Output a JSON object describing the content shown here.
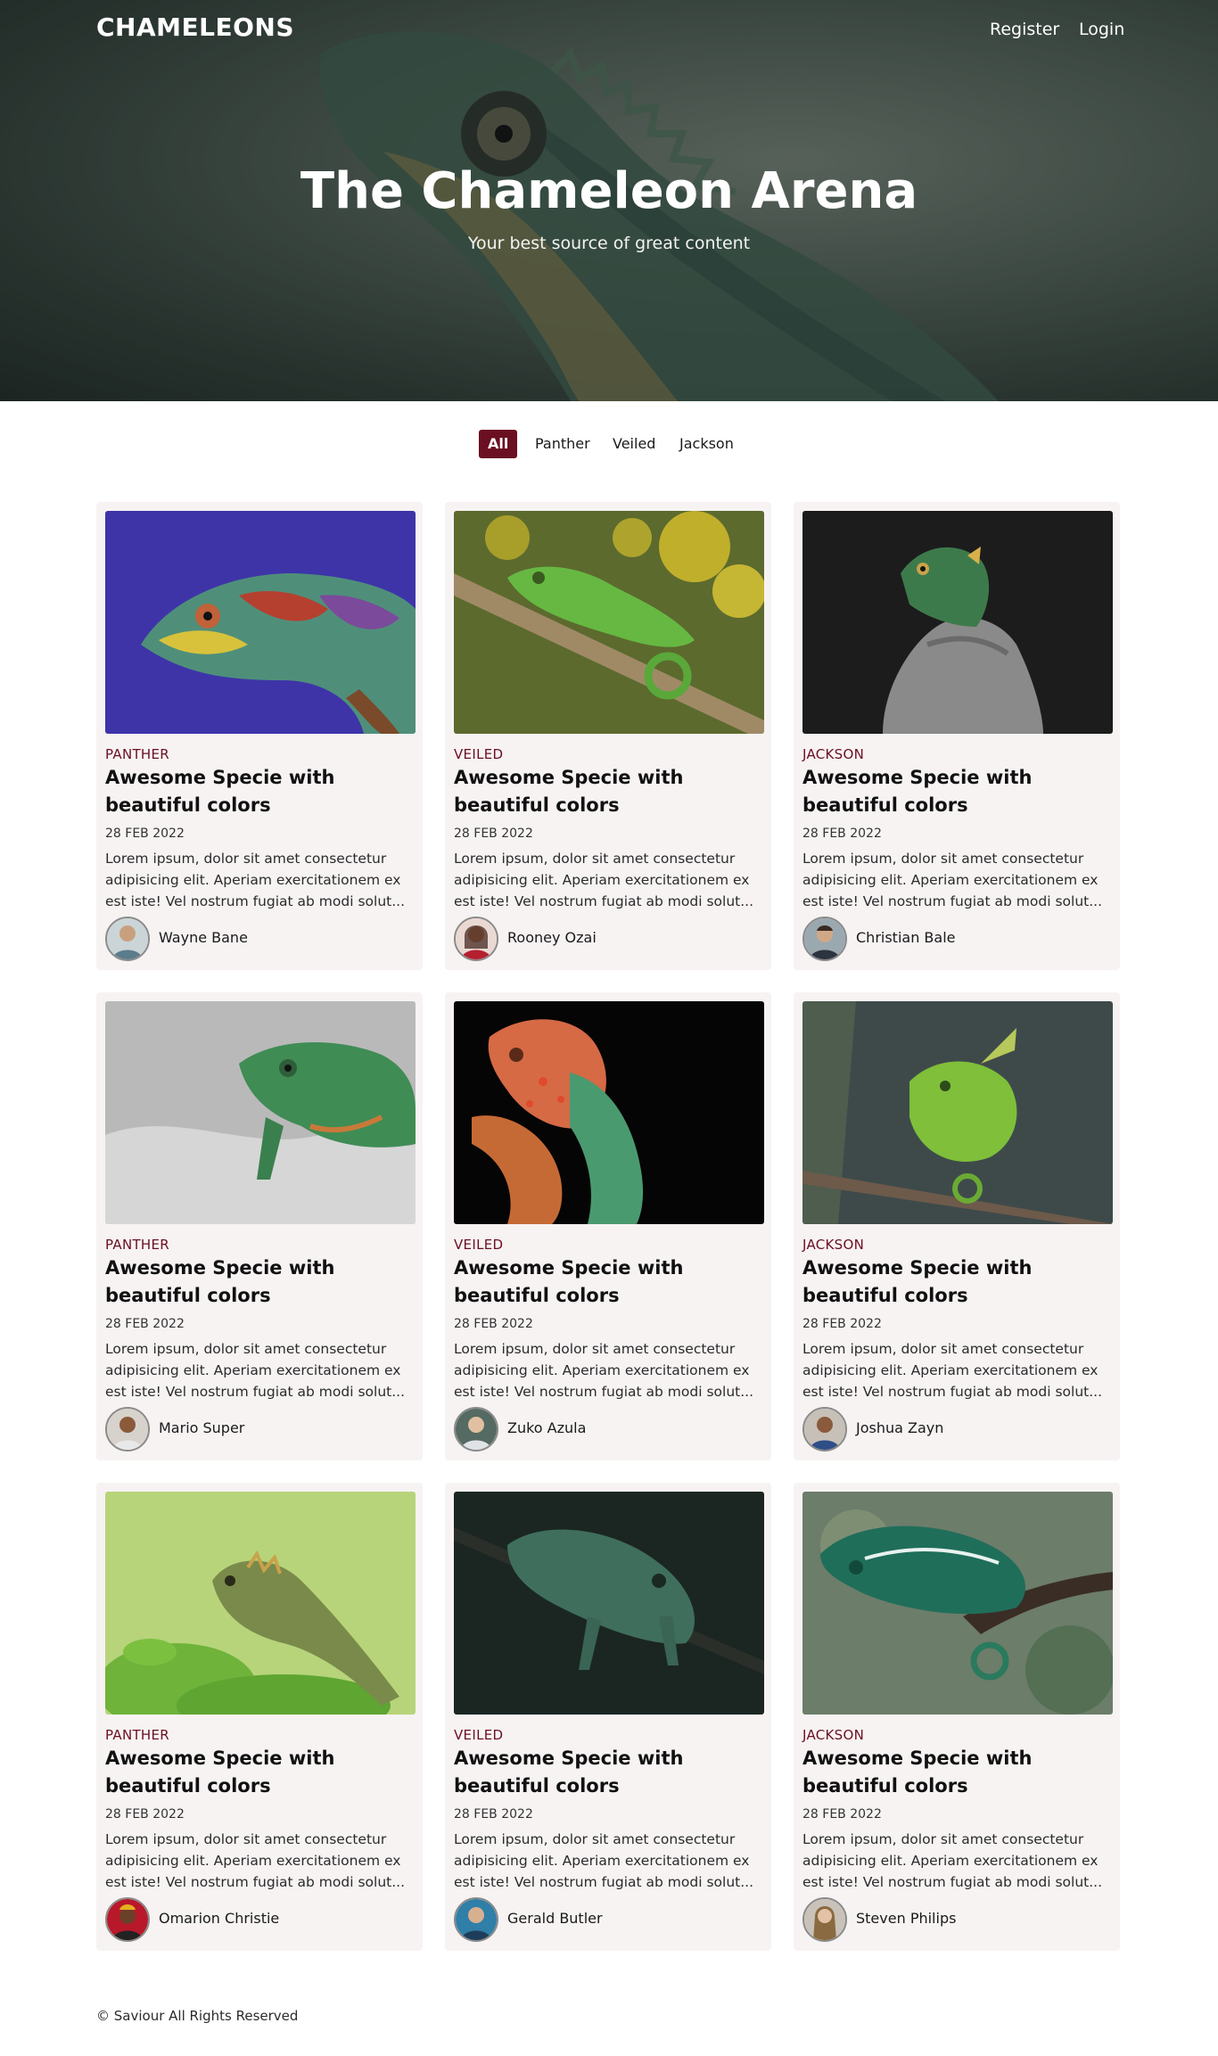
{
  "navbar": {
    "brand": "CHAMELEONS",
    "links": [
      "Register",
      "Login"
    ]
  },
  "hero": {
    "title": "The Chameleon Arena",
    "subtitle": "Your best source of great content"
  },
  "filters": {
    "items": [
      "All",
      "Panther",
      "Veiled",
      "Jackson"
    ],
    "active": "All"
  },
  "posts": [
    {
      "category": "PANTHER",
      "title": "Awesome Specie with beautiful colors",
      "date": "28 FEB 2022",
      "excerpt": "Lorem ipsum, dolor sit amet consectetur adipisicing elit. Aperiam exercitationem ex est iste! Vel nostrum fugiat ab modi solut...",
      "author": "Wayne Bane"
    },
    {
      "category": "VEILED",
      "title": "Awesome Specie with beautiful colors",
      "date": "28 FEB 2022",
      "excerpt": "Lorem ipsum, dolor sit amet consectetur adipisicing elit. Aperiam exercitationem ex est iste! Vel nostrum fugiat ab modi solut...",
      "author": "Rooney Ozai"
    },
    {
      "category": "JACKSON",
      "title": "Awesome Specie with beautiful colors",
      "date": "28 FEB 2022",
      "excerpt": "Lorem ipsum, dolor sit amet consectetur adipisicing elit. Aperiam exercitationem ex est iste! Vel nostrum fugiat ab modi solut...",
      "author": "Christian Bale"
    },
    {
      "category": "PANTHER",
      "title": "Awesome Specie with beautiful colors",
      "date": "28 FEB 2022",
      "excerpt": "Lorem ipsum, dolor sit amet consectetur adipisicing elit. Aperiam exercitationem ex est iste! Vel nostrum fugiat ab modi solut...",
      "author": "Mario Super"
    },
    {
      "category": "VEILED",
      "title": "Awesome Specie with beautiful colors",
      "date": "28 FEB 2022",
      "excerpt": "Lorem ipsum, dolor sit amet consectetur adipisicing elit. Aperiam exercitationem ex est iste! Vel nostrum fugiat ab modi solut...",
      "author": "Zuko Azula"
    },
    {
      "category": "JACKSON",
      "title": "Awesome Specie with beautiful colors",
      "date": "28 FEB 2022",
      "excerpt": "Lorem ipsum, dolor sit amet consectetur adipisicing elit. Aperiam exercitationem ex est iste! Vel nostrum fugiat ab modi solut...",
      "author": "Joshua Zayn"
    },
    {
      "category": "PANTHER",
      "title": "Awesome Specie with beautiful colors",
      "date": "28 FEB 2022",
      "excerpt": "Lorem ipsum, dolor sit amet consectetur adipisicing elit. Aperiam exercitationem ex est iste! Vel nostrum fugiat ab modi solut...",
      "author": "Omarion Christie"
    },
    {
      "category": "VEILED",
      "title": "Awesome Specie with beautiful colors",
      "date": "28 FEB 2022",
      "excerpt": "Lorem ipsum, dolor sit amet consectetur adipisicing elit. Aperiam exercitationem ex est iste! Vel nostrum fugiat ab modi solut...",
      "author": "Gerald Butler"
    },
    {
      "category": "JACKSON",
      "title": "Awesome Specie with beautiful colors",
      "date": "28 FEB 2022",
      "excerpt": "Lorem ipsum, dolor sit amet consectetur adipisicing elit. Aperiam exercitationem ex est iste! Vel nostrum fugiat ab modi solut...",
      "author": "Steven Philips"
    }
  ],
  "footer": {
    "copyright": "© Saviour All Rights Reserved"
  },
  "colors": {
    "accent": "#6b0f22",
    "card_background": "#f7f3f3"
  }
}
